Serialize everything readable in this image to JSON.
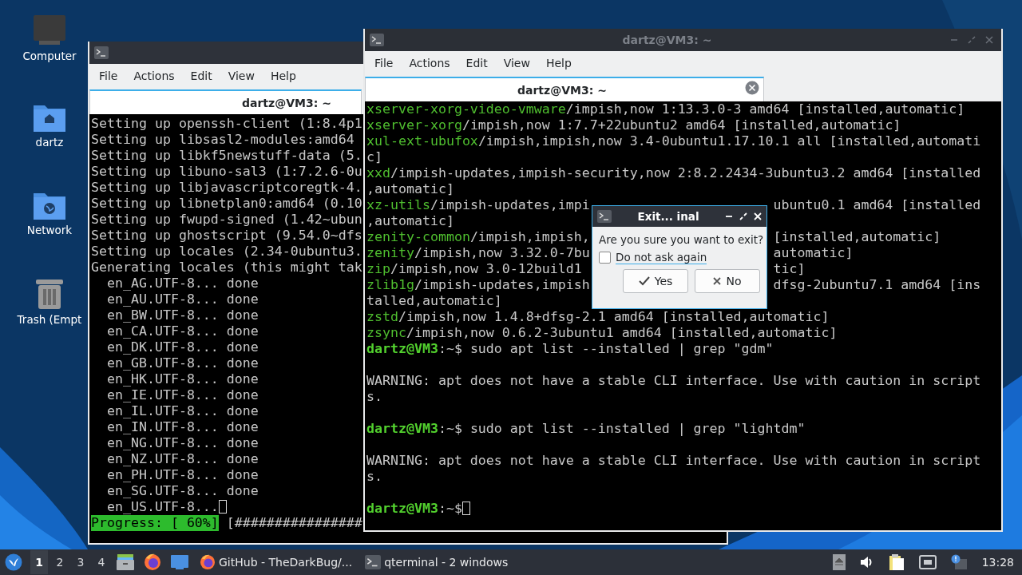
{
  "desktop_icons": [
    {
      "kind": "computer",
      "label": "Computer"
    },
    {
      "kind": "home",
      "label": "dartz"
    },
    {
      "kind": "network",
      "label": "Network"
    },
    {
      "kind": "trash",
      "label": "Trash (Empt"
    }
  ],
  "left_window": {
    "menu": [
      "File",
      "Actions",
      "Edit",
      "View",
      "Help"
    ],
    "tab": {
      "title": "dartz@VM3: ~"
    },
    "lines": [
      "Setting up openssh-client (1:8.4p1",
      "Setting up libsasl2-modules:amd64",
      "Setting up libkf5newstuff-data (5.",
      "Setting up libuno-sal3 (1:7.2.6-0u",
      "Setting up libjavascriptcoregtk-4.",
      "Setting up libnetplan0:amd64 (0.10",
      "Setting up fwupd-signed (1.42~ubun",
      "Setting up ghostscript (9.54.0~dfs",
      "Setting up locales (2.34-0ubuntu3.",
      "Generating locales (this might tak",
      "  en_AG.UTF-8... done",
      "  en_AU.UTF-8... done",
      "  en_BW.UTF-8... done",
      "  en_CA.UTF-8... done",
      "  en_DK.UTF-8... done",
      "  en_GB.UTF-8... done",
      "  en_HK.UTF-8... done",
      "  en_IE.UTF-8... done",
      "  en_IL.UTF-8... done",
      "  en_IN.UTF-8... done",
      "  en_NG.UTF-8... done",
      "  en_NZ.UTF-8... done",
      "  en_PH.UTF-8... done",
      "  en_SG.UTF-8... done",
      "  en_US.UTF-8..."
    ],
    "cursor": true,
    "progress": {
      "label": "Progress: [ 60%]",
      "bar": "[################"
    }
  },
  "right_window": {
    "title": "dartz@VM3: ~",
    "menu": [
      "File",
      "Actions",
      "Edit",
      "View",
      "Help"
    ],
    "tab": {
      "title": "dartz@VM3: ~"
    },
    "lines": [
      {
        "kind": "text",
        "segments": [
          {
            "kind": "package",
            "text": "xserver-xorg-video-vmware"
          },
          {
            "kind": "text",
            "text": "/impish,now 1:13.3.0-3 amd64 [installed,automatic]"
          }
        ]
      },
      {
        "kind": "text",
        "segments": [
          {
            "kind": "package",
            "text": "xserver-xorg"
          },
          {
            "kind": "text",
            "text": "/impish,now 1:7.7+22ubuntu2 amd64 [installed,automatic]"
          }
        ]
      },
      {
        "kind": "text",
        "segments": [
          {
            "kind": "package",
            "text": "xul-ext-ubufox"
          },
          {
            "kind": "text",
            "text": "/impish,impish,now 3.4-0ubuntu1.17.10.1 all [installed,automati"
          }
        ]
      },
      {
        "kind": "text",
        "segments": [
          {
            "kind": "text",
            "text": "c]"
          }
        ]
      },
      {
        "kind": "text",
        "segments": [
          {
            "kind": "package",
            "text": "xxd"
          },
          {
            "kind": "text",
            "text": "/impish-updates,impish-security,now 2:8.2.2434-3ubuntu3.2 amd64 [installed"
          }
        ]
      },
      {
        "kind": "text",
        "segments": [
          {
            "kind": "text",
            "text": ",automatic]"
          }
        ]
      },
      {
        "kind": "text",
        "segments": [
          {
            "kind": "package",
            "text": "xz-utils"
          },
          {
            "kind": "text",
            "text": "/impish-updates,impi"
          }
        ],
        "after": "ubuntu0.1 amd64 [installed"
      },
      {
        "kind": "text",
        "segments": [
          {
            "kind": "text",
            "text": ",automatic]"
          }
        ]
      },
      {
        "kind": "text",
        "segments": [
          {
            "kind": "package",
            "text": "zenity-common"
          },
          {
            "kind": "text",
            "text": "/impish,impish,"
          }
        ],
        "after": "[installed,automatic]"
      },
      {
        "kind": "text",
        "segments": [
          {
            "kind": "package",
            "text": "zenity"
          },
          {
            "kind": "text",
            "text": "/impish,now 3.32.0-7bu"
          }
        ],
        "after": "automatic]"
      },
      {
        "kind": "text",
        "segments": [
          {
            "kind": "package",
            "text": "zip"
          },
          {
            "kind": "text",
            "text": "/impish,now 3.0-12build1"
          }
        ],
        "after": "tic]"
      },
      {
        "kind": "text",
        "segments": [
          {
            "kind": "package",
            "text": "zlib1g"
          },
          {
            "kind": "text",
            "text": "/impish-updates,impish"
          }
        ],
        "after": "dfsg-2ubuntu7.1 amd64 [ins"
      },
      {
        "kind": "text",
        "segments": [
          {
            "kind": "text",
            "text": "talled,automatic]"
          }
        ]
      },
      {
        "kind": "text",
        "segments": [
          {
            "kind": "package",
            "text": "zstd"
          },
          {
            "kind": "text",
            "text": "/impish,now 1.4.8+dfsg-2.1 amd64 [installed,automatic]"
          }
        ]
      },
      {
        "kind": "text",
        "segments": [
          {
            "kind": "package",
            "text": "zsync"
          },
          {
            "kind": "text",
            "text": "/impish,now 0.6.2-3ubuntu1 amd64 [installed,automatic]"
          }
        ]
      },
      {
        "kind": "text",
        "segments": [
          {
            "kind": "user",
            "text": "dartz@VM3"
          },
          {
            "kind": "text",
            "text": ":~$ sudo apt list --installed | grep \"gdm\""
          }
        ]
      },
      {
        "kind": "blank"
      },
      {
        "kind": "text",
        "segments": [
          {
            "kind": "text",
            "text": "WARNING: apt does not have a stable CLI interface. Use with caution in script"
          }
        ]
      },
      {
        "kind": "text",
        "segments": [
          {
            "kind": "text",
            "text": "s."
          }
        ]
      },
      {
        "kind": "blank"
      },
      {
        "kind": "text",
        "segments": [
          {
            "kind": "user",
            "text": "dartz@VM3"
          },
          {
            "kind": "text",
            "text": ":~$ sudo apt list --installed | grep \"lightdm\""
          }
        ]
      },
      {
        "kind": "blank"
      },
      {
        "kind": "text",
        "segments": [
          {
            "kind": "text",
            "text": "WARNING: apt does not have a stable CLI interface. Use with caution in script"
          }
        ]
      },
      {
        "kind": "text",
        "segments": [
          {
            "kind": "text",
            "text": "s."
          }
        ]
      },
      {
        "kind": "blank"
      },
      {
        "kind": "text",
        "segments": [
          {
            "kind": "user",
            "text": "dartz@VM3"
          },
          {
            "kind": "text",
            "text": ":~$"
          }
        ]
      }
    ],
    "cursor": true
  },
  "dialog": {
    "title": "Exit... inal",
    "message": "Are you sure you want to exit?",
    "checkbox": {
      "label": "Do not ask again",
      "checked": false
    },
    "buttons": [
      {
        "kind": "yes",
        "label": "Yes"
      },
      {
        "kind": "no",
        "label": "No"
      }
    ]
  },
  "taskbar": {
    "workspaces": [
      {
        "label": "1",
        "selected": true
      },
      {
        "label": "2",
        "selected": false
      },
      {
        "label": "3",
        "selected": false
      },
      {
        "label": "4",
        "selected": false
      }
    ],
    "launchers": [
      {
        "kind": "files"
      },
      {
        "kind": "firefox"
      },
      {
        "kind": "desktop"
      }
    ],
    "tasks": [
      {
        "kind": "firefox",
        "label": "GitHub - TheDarkBug/..."
      },
      {
        "kind": "terminal",
        "label": "qterminal - 2 windows"
      }
    ],
    "tray": [
      {
        "kind": "eject"
      },
      {
        "kind": "volume"
      },
      {
        "kind": "clipboard"
      },
      {
        "kind": "network"
      },
      {
        "kind": "notification"
      }
    ],
    "clock": "13:28"
  }
}
